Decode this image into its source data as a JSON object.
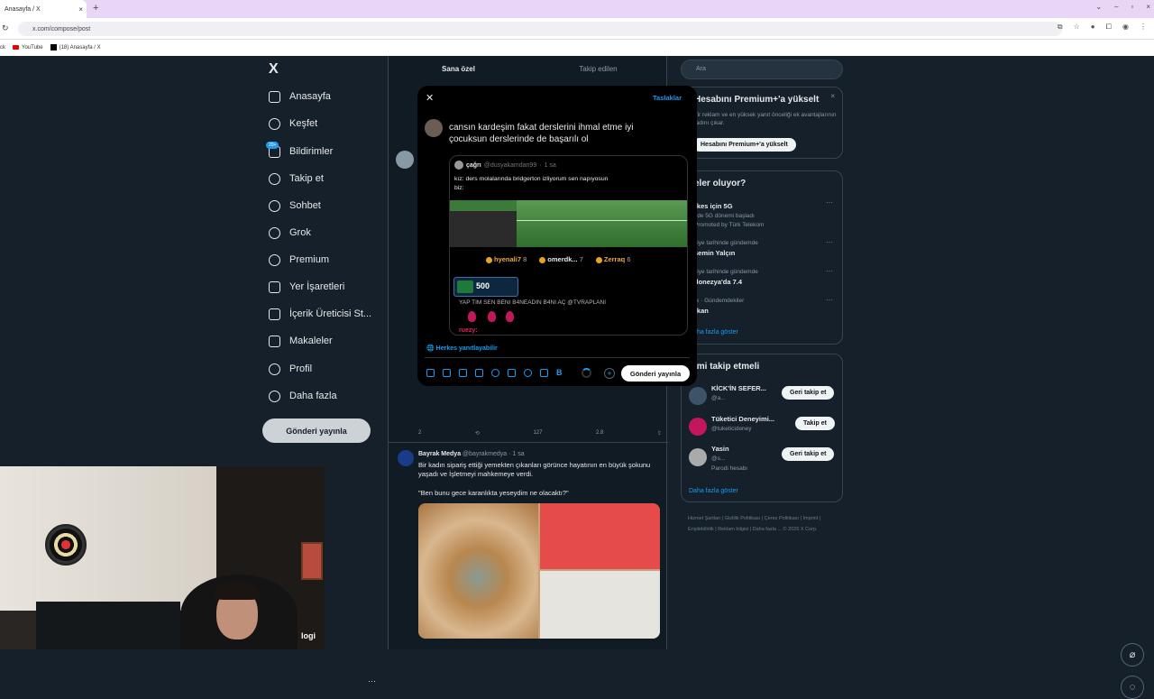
{
  "browser": {
    "tab_title": "Anasayfa / X",
    "url": "x.com/compose/post",
    "bookmarks": [
      "ck",
      "YouTube",
      "(18) Anasayfa / X"
    ]
  },
  "sidebar": {
    "badge": "20+",
    "items": [
      {
        "label": "Anasayfa",
        "icon": "home-icon"
      },
      {
        "label": "Keşfet",
        "icon": "search-icon"
      },
      {
        "label": "Bildirimler",
        "icon": "bell-icon"
      },
      {
        "label": "Takip et",
        "icon": "follow-icon"
      },
      {
        "label": "Sohbet",
        "icon": "chat-icon"
      },
      {
        "label": "Grok",
        "icon": "grok-icon"
      },
      {
        "label": "Premium",
        "icon": "premium-icon"
      },
      {
        "label": "Yer İşaretleri",
        "icon": "bookmark-icon"
      },
      {
        "label": "İçerik Üreticisi St...",
        "icon": "rocket-icon"
      },
      {
        "label": "Makaleler",
        "icon": "article-icon"
      },
      {
        "label": "Profil",
        "icon": "person-icon"
      },
      {
        "label": "Daha fazla",
        "icon": "more-icon"
      }
    ],
    "post_button": "Gönderi yayınla"
  },
  "feed": {
    "tabs": [
      "Sana özel",
      "Takip edilen"
    ],
    "post1_actions": [
      "2",
      "",
      "127",
      "2.8"
    ],
    "post2": {
      "author": "Bayrak Medya",
      "handle": "@bayrakmedya",
      "time": "1 sa",
      "text": "Bir kadın sipariş ettiği yemekten çıkanları görünce hayatının en büyük şokunu yaşadı ve İşletmeyi mahkemeye verdi.",
      "quote": "\"Ben bunu gece karanlıkta yeseydim ne olacaktı?\""
    }
  },
  "right": {
    "search_placeholder": "Ara",
    "premium": {
      "title": "Hesabını Premium+'a yükselt",
      "text": "ıfir reklam ve en yüksek yanıt önceliği ek avantajlarının tadını çıkar.",
      "button": "Hesabını Premium+'a yükselt"
    },
    "trends": {
      "title": "eler oluyor?",
      "items": [
        {
          "meta": "",
          "name": "rkes için 5G",
          "sub": "ılde 5G dönemi başladı"
        },
        {
          "meta": "Promoted by Türk Telekom",
          "name": "",
          "sub": ""
        },
        {
          "meta": "kiye tarihinde gündemde",
          "name": "semin Yalçın",
          "sub": ""
        },
        {
          "meta": "kiye tarihinde gündemde",
          "name": "donezya'da 7.4",
          "sub": ""
        },
        {
          "meta": "rk · Gündemdekiler",
          "name": "rkan",
          "sub": ""
        }
      ],
      "more": "Daha fazla göster"
    },
    "who_to_follow": {
      "title": "imi takip etmeli",
      "items": [
        {
          "name": "KİCK'İN SEFER...",
          "handle": "@a...",
          "button": "Geri takip et"
        },
        {
          "name": "Tüketici Deneyimi...",
          "handle": "@tuketicideney",
          "button": "Takip et"
        },
        {
          "name": "Yasin",
          "handle": "@s...",
          "sub": "Parodi hesabı",
          "button": "Geri takip et"
        }
      ],
      "more": "Daha fazla göster"
    },
    "footer": "Hizmet Şartları | Gizlilik Politikası | Çerez Politikası | İmprint | Erişilebilirlik | Reklam bilgisi | Daha fazla ... © 2026 X Corp."
  },
  "modal": {
    "drafts": "Taslaklar",
    "text": "cansın kardeşim fakat derslerini ihmal etme iyi çocuksun derslerinde de başarılı ol",
    "quote": {
      "name": "çağrı",
      "handle": "@dusyakamdan99",
      "time": "1 sa",
      "text_line1": "kız: ders molalarında bridgerton izliyorum sen napıyosun",
      "text_line2": "biz:",
      "donors": [
        {
          "name": "hyenali7",
          "count": "8"
        },
        {
          "name": "omerdk...",
          "count": "7"
        },
        {
          "name": "Zerraq",
          "count": "6"
        }
      ],
      "box_value": "500",
      "banner": "YAP TIM SEN BENI B4NEADIN B4NI AÇ @TVRAPLANI",
      "rupe": "ruezy:"
    },
    "reply_setting": "Herkes yanıtlayabilir",
    "post_button": "Gönderi yayınla"
  },
  "webcam": {
    "overlay": "logi"
  }
}
